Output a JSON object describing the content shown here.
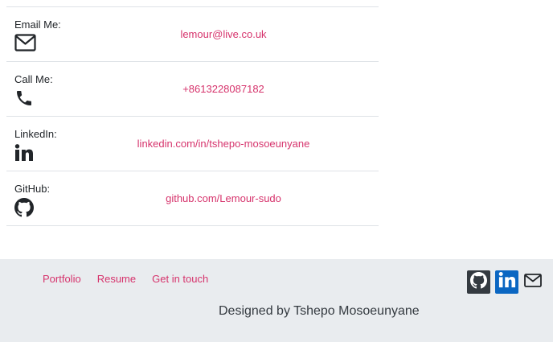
{
  "contact": {
    "rows": [
      {
        "label": "Email Me:",
        "icon": "envelope-icon",
        "value": "lemour@live.co.uk"
      },
      {
        "label": "Call Me:",
        "icon": "phone-icon",
        "value": "+8613228087182"
      },
      {
        "label": "LinkedIn:",
        "icon": "linkedin-icon",
        "value": "linkedin.com/in/tshepo-mosoeunyane"
      },
      {
        "label": "GitHub:",
        "icon": "github-icon",
        "value": "github.com/Lemour-sudo"
      }
    ]
  },
  "footer": {
    "nav": [
      "Portfolio",
      "Resume",
      "Get in touch"
    ],
    "social_icons": [
      "github-icon",
      "linkedin-icon",
      "envelope-icon"
    ],
    "designed_by": "Designed by Tshepo Mosoeunyane"
  },
  "colors": {
    "link": "#d6336c",
    "footer_bg": "#e9ecef",
    "github_btn": "#343a40",
    "linkedin_btn": "#0a66c2",
    "divider": "#dee2e6"
  }
}
